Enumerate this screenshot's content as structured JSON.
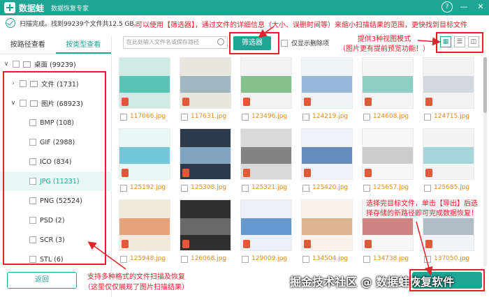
{
  "titlebar": {
    "app_name": "数据蛙",
    "subtitle": "数据恢复专家",
    "help": "?",
    "minimize": "—",
    "close": "✕"
  },
  "status": {
    "text": "扫描完成。找到99239个文件共12.5 GB。"
  },
  "notes": {
    "top": "可以使用【筛选器】，通过文件的详细信息（大小、误删时间等）来缩小扫描结果的范围，更快找到目标文件",
    "right_line1": "提供3种视图模式",
    "right_line2": "（图片更有提前预览功能！）",
    "bottom_line1": "选择完目标文件，单击【导出】后选",
    "bottom_line2": "择存储的新路径即可完成数据恢复！",
    "left_line1": "支持多种格式的文件扫描及恢复",
    "left_line2": "（这里仅仅展现了图片扫描结果）"
  },
  "tabs": [
    {
      "label": "按路径查看"
    },
    {
      "label": "按类型查看"
    }
  ],
  "tree": {
    "desktop": "桌面 (99239)",
    "files": "文件 (1731)",
    "images": "图片 (68923)",
    "types": [
      "BMP (108)",
      "GIF (2988)",
      "ICO (834)",
      "JPG (11231)",
      "PNG (52524)",
      "PSD (2)",
      "SCR (3)",
      "STL (6)"
    ]
  },
  "toolbar": {
    "search_placeholder": "在此处输入文件名或保存路径",
    "filter_label": "筛选器",
    "only_deleted": "仅显示删除项"
  },
  "files": [
    "117066.jpg",
    "117631.jpg",
    "123496.jpg",
    "124219.jpg",
    "124608.jpg",
    "124715.jpg",
    "125192.jpg",
    "125308.jpg",
    "125321.jpg",
    "125420.jpg",
    "125657.jpg",
    "125685.jpg",
    "125948.jpg",
    "126068.jpg",
    "129009.jpg",
    "134504.jpg",
    "134738.jpg",
    "137050.jpg"
  ],
  "buttons": {
    "back": "返回"
  },
  "watermark": "掘金技术社区 @ 数据蛙恢复软件",
  "colors": {
    "accent": "#1fa594",
    "annotation_red": "#e8202a",
    "filename": "#e08a1e"
  }
}
